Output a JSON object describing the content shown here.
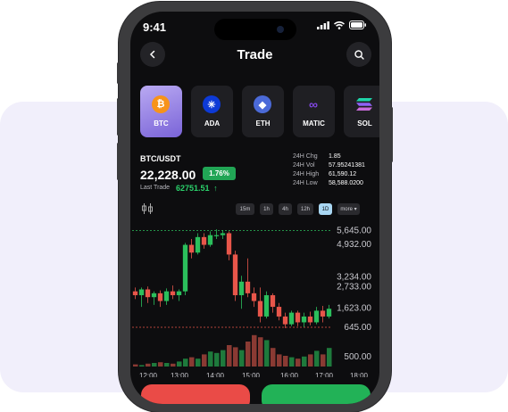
{
  "status_bar": {
    "time": "9:41"
  },
  "header": {
    "title": "Trade",
    "back_icon": "chevron-left-icon",
    "search_icon": "search-icon"
  },
  "coins": [
    {
      "symbol": "BTC",
      "icon": "bitcoin-icon",
      "color": "#f7931a",
      "active": true
    },
    {
      "symbol": "ADA",
      "icon": "cardano-icon",
      "color": "#0d3ad6",
      "active": false
    },
    {
      "symbol": "ETH",
      "icon": "ethereum-icon",
      "color": "#4b6ad8",
      "active": false
    },
    {
      "symbol": "MATIC",
      "icon": "polygon-icon",
      "color": "#8247e5",
      "active": false
    },
    {
      "symbol": "SOL",
      "icon": "solana-icon",
      "color": "#1fd3a8",
      "active": false
    }
  ],
  "ticker": {
    "pair": "BTC/USDT",
    "price": "22,228.00",
    "change_badge": "1.76%",
    "last_trade_label": "Last Trade",
    "last_trade_value": "62751.51"
  },
  "stats": [
    {
      "label": "24H Chg",
      "value": "1.85"
    },
    {
      "label": "24H Vol",
      "value": "57.95241381"
    },
    {
      "label": "24H High",
      "value": "61,590.12"
    },
    {
      "label": "24H Low",
      "value": "58,588.0200"
    }
  ],
  "timeframes": [
    {
      "label": "15m",
      "active": false
    },
    {
      "label": "1h",
      "active": false
    },
    {
      "label": "4h",
      "active": false
    },
    {
      "label": "12h",
      "active": false
    },
    {
      "label": "1D",
      "active": true
    },
    {
      "label": "more ▾",
      "active": false
    }
  ],
  "colors": {
    "up": "#2bbf5c",
    "down": "#e8564a",
    "accent": "#7a64d8"
  },
  "chart_data": {
    "type": "candlestick",
    "x_ticks": [
      "12:00",
      "13:00",
      "14:00",
      "15:00",
      "16:00",
      "17:00",
      "18:00"
    ],
    "y_ticks": [
      "5,645.00",
      "4,932.00",
      "3,234.00",
      "2,733.00",
      "1,623.00",
      "645.00",
      "500.00"
    ],
    "candles": [
      {
        "o": 2500,
        "h": 2700,
        "l": 2100,
        "c": 2300
      },
      {
        "o": 2300,
        "h": 2700,
        "l": 1700,
        "c": 2600
      },
      {
        "o": 2600,
        "h": 2750,
        "l": 1900,
        "c": 2200
      },
      {
        "o": 2200,
        "h": 2500,
        "l": 1800,
        "c": 2400
      },
      {
        "o": 2400,
        "h": 2550,
        "l": 1700,
        "c": 2000
      },
      {
        "o": 2000,
        "h": 2650,
        "l": 1800,
        "c": 2500
      },
      {
        "o": 2500,
        "h": 2800,
        "l": 2100,
        "c": 2300
      },
      {
        "o": 2300,
        "h": 2600,
        "l": 2000,
        "c": 2500
      },
      {
        "o": 2500,
        "h": 5000,
        "l": 2300,
        "c": 4900
      },
      {
        "o": 4900,
        "h": 5200,
        "l": 4200,
        "c": 4500
      },
      {
        "o": 4500,
        "h": 5500,
        "l": 4400,
        "c": 5300
      },
      {
        "o": 5300,
        "h": 5500,
        "l": 4700,
        "c": 4900
      },
      {
        "o": 4900,
        "h": 5600,
        "l": 4800,
        "c": 5400
      },
      {
        "o": 5400,
        "h": 5700,
        "l": 5200,
        "c": 5400
      },
      {
        "o": 5400,
        "h": 5650,
        "l": 5200,
        "c": 5500
      },
      {
        "o": 5500,
        "h": 5600,
        "l": 4100,
        "c": 4400
      },
      {
        "o": 4400,
        "h": 4600,
        "l": 2000,
        "c": 2300
      },
      {
        "o": 2300,
        "h": 3300,
        "l": 1600,
        "c": 3000
      },
      {
        "o": 3000,
        "h": 4200,
        "l": 2200,
        "c": 2400
      },
      {
        "o": 2400,
        "h": 2700,
        "l": 1700,
        "c": 2000
      },
      {
        "o": 2000,
        "h": 2700,
        "l": 900,
        "c": 1200
      },
      {
        "o": 1200,
        "h": 2500,
        "l": 1100,
        "c": 2300
      },
      {
        "o": 2300,
        "h": 2400,
        "l": 1400,
        "c": 1700
      },
      {
        "o": 1700,
        "h": 1900,
        "l": 1000,
        "c": 1200
      },
      {
        "o": 1200,
        "h": 1400,
        "l": 600,
        "c": 800
      },
      {
        "o": 800,
        "h": 1500,
        "l": 700,
        "c": 1400
      },
      {
        "o": 1400,
        "h": 1500,
        "l": 700,
        "c": 900
      },
      {
        "o": 900,
        "h": 1400,
        "l": 650,
        "c": 1200
      },
      {
        "o": 1200,
        "h": 1450,
        "l": 750,
        "c": 900
      },
      {
        "o": 900,
        "h": 1700,
        "l": 800,
        "c": 1500
      },
      {
        "o": 1500,
        "h": 1750,
        "l": 900,
        "c": 1200
      },
      {
        "o": 1200,
        "h": 1800,
        "l": 1100,
        "c": 1600
      }
    ],
    "volumes": [
      3,
      2,
      4,
      5,
      6,
      5,
      4,
      7,
      11,
      13,
      11,
      17,
      21,
      19,
      23,
      30,
      27,
      23,
      35,
      44,
      41,
      37,
      26,
      17,
      15,
      13,
      11,
      14,
      17,
      22,
      17,
      26
    ]
  },
  "actions": {
    "sell_color": "#ea4b47",
    "buy_color": "#22b257"
  }
}
